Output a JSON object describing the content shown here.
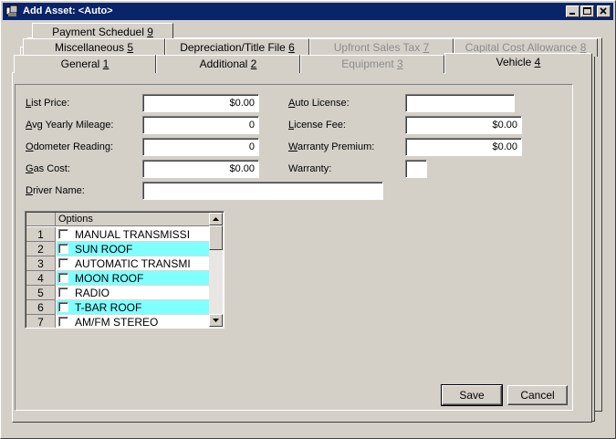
{
  "window": {
    "title": "Add Asset: <Auto>"
  },
  "tabs": {
    "row1": [
      {
        "label": "Payment Scheduel ",
        "key": "9",
        "disabled": false
      }
    ],
    "row2": [
      {
        "label": "Miscellaneous ",
        "key": "5",
        "disabled": false
      },
      {
        "label": "Depreciation/Title File ",
        "key": "6",
        "disabled": false
      },
      {
        "label": "Upfront Sales Tax ",
        "key": "7",
        "disabled": true
      },
      {
        "label": "Capital Cost Allowance ",
        "key": "8",
        "disabled": true
      }
    ],
    "row3": [
      {
        "label": "General ",
        "key": "1",
        "disabled": false
      },
      {
        "label": "Additional ",
        "key": "2",
        "disabled": false
      },
      {
        "label": "Equipment ",
        "key": "3",
        "disabled": true
      },
      {
        "label": "Vehicle ",
        "key": "4",
        "disabled": false,
        "active": true
      }
    ]
  },
  "form": {
    "list_price": {
      "k": "L",
      "rest": "ist Price:",
      "value": "$0.00"
    },
    "avg_mileage": {
      "k": "A",
      "rest": "vg Yearly Mileage:",
      "value": "0"
    },
    "odometer": {
      "k": "O",
      "rest": "dometer Reading:",
      "value": "0"
    },
    "gas_cost": {
      "k": "G",
      "rest": "as Cost:",
      "value": "$0.00"
    },
    "driver_name": {
      "k": "D",
      "rest": "river Name:",
      "value": ""
    },
    "auto_license": {
      "k": "A",
      "rest": "uto License:",
      "value": ""
    },
    "license_fee": {
      "k": "L",
      "rest": "icense Fee:",
      "value": "$0.00"
    },
    "warranty_premium": {
      "k": "W",
      "rest": "arranty Premium:",
      "value": "$0.00"
    },
    "warranty": {
      "k": "",
      "rest": "Warranty:",
      "value": ""
    }
  },
  "options_grid": {
    "header": "Options",
    "rows": [
      {
        "num": "1",
        "label": "MANUAL TRANSMISSI"
      },
      {
        "num": "2",
        "label": "SUN ROOF"
      },
      {
        "num": "3",
        "label": "AUTOMATIC TRANSMI"
      },
      {
        "num": "4",
        "label": "MOON ROOF"
      },
      {
        "num": "5",
        "label": "RADIO"
      },
      {
        "num": "6",
        "label": "T-BAR ROOF"
      },
      {
        "num": "7",
        "label": "AM/FM STEREO"
      }
    ]
  },
  "buttons": {
    "save": "Save",
    "cancel": "Cancel"
  }
}
